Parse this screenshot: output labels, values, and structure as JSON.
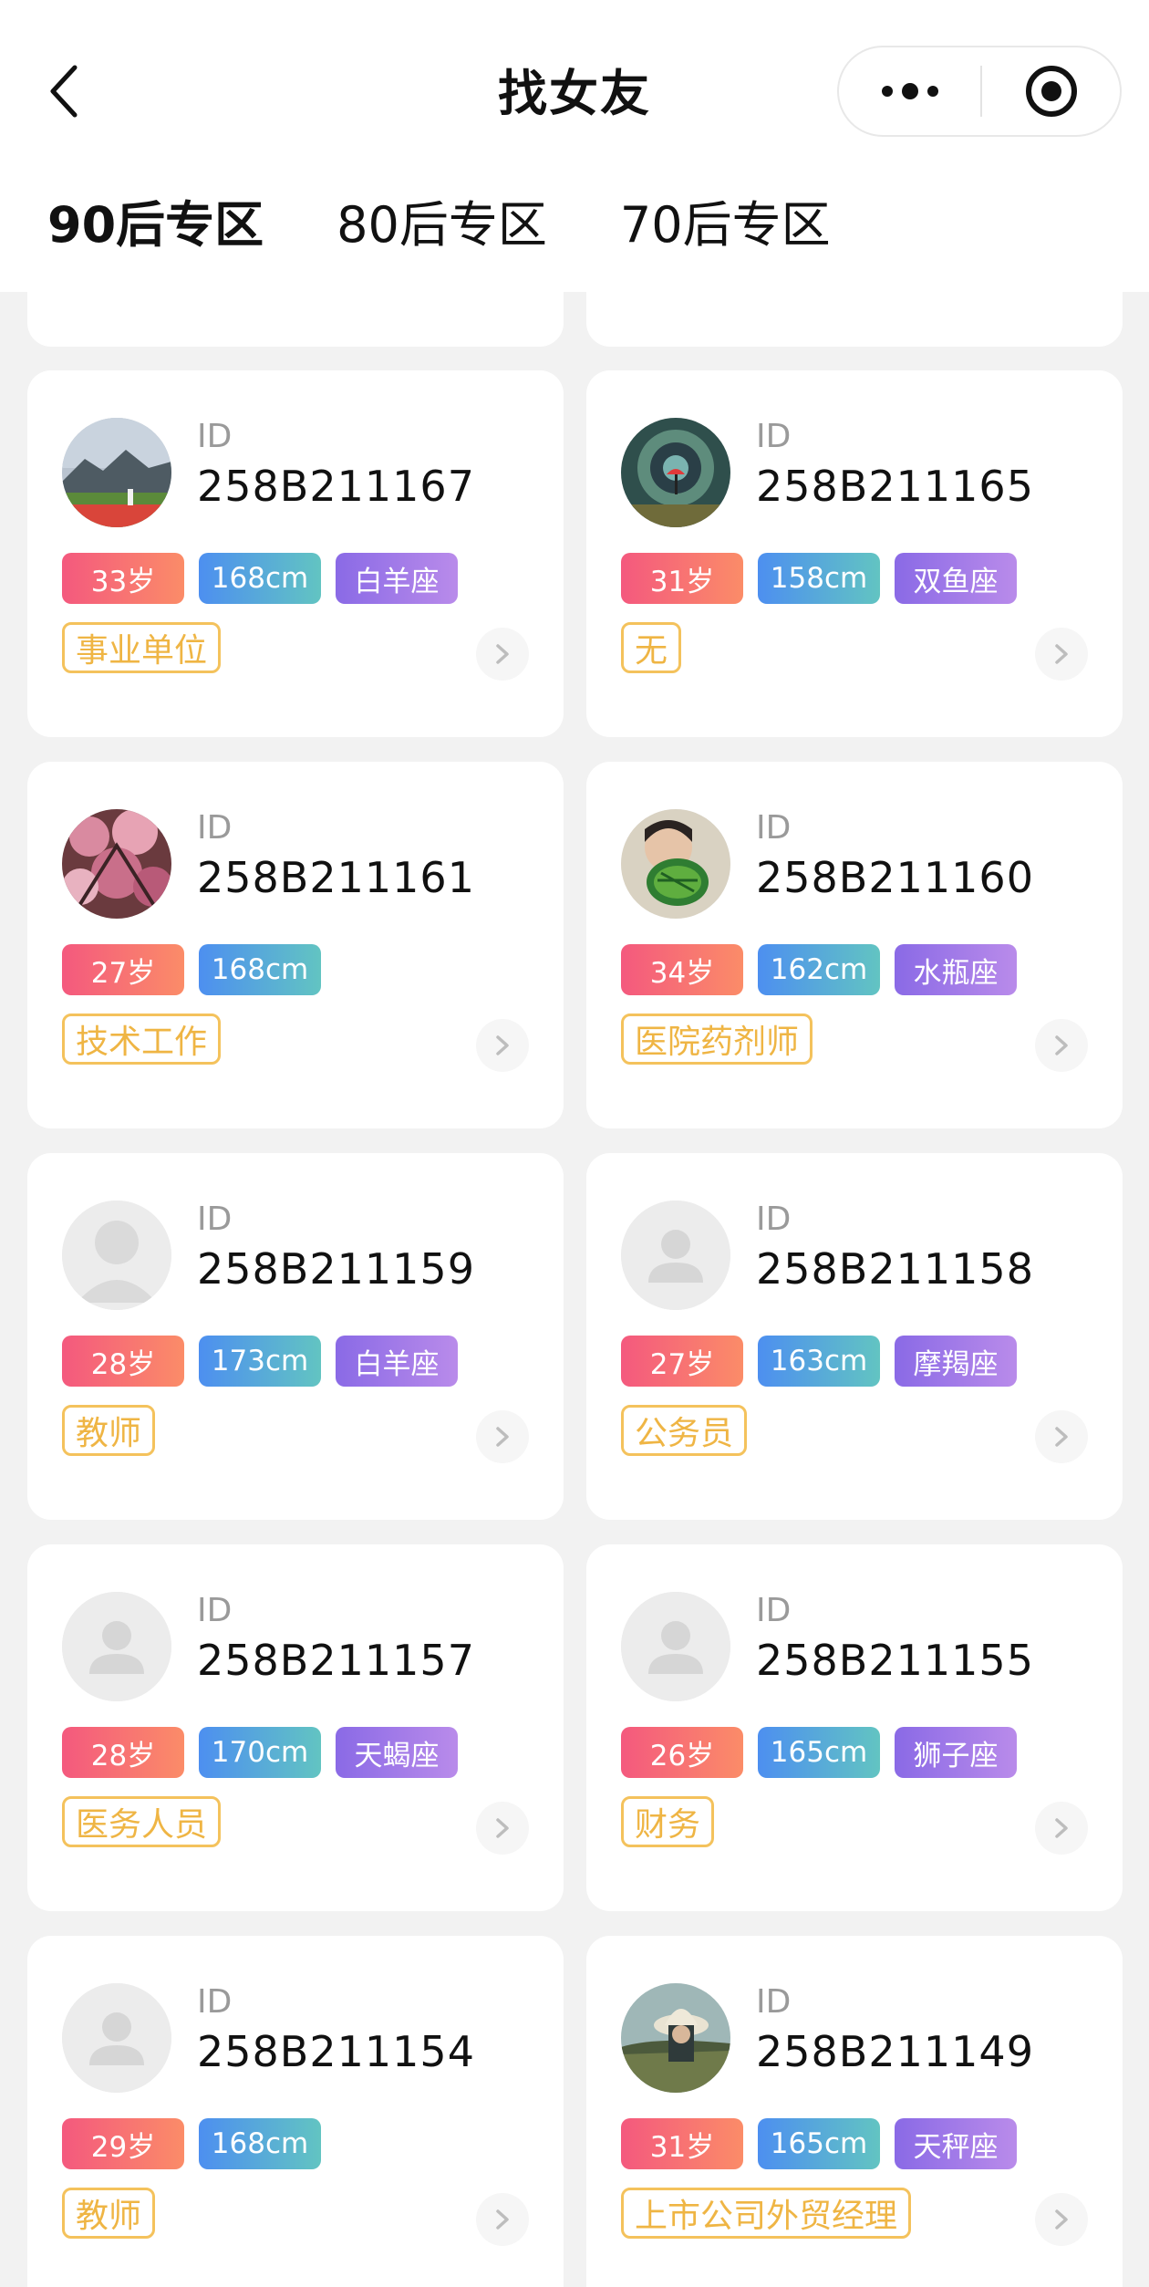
{
  "header": {
    "title": "找女友"
  },
  "tabs": [
    "90后专区",
    "80后专区",
    "70后专区"
  ],
  "profiles": [
    {
      "id_label": "ID",
      "id": "258B211167",
      "age": "33岁",
      "height": "168cm",
      "zodiac": "白羊座",
      "job": "事业单位",
      "avatar": "photo-mountains"
    },
    {
      "id_label": "ID",
      "id": "258B211165",
      "age": "31岁",
      "height": "158cm",
      "zodiac": "双鱼座",
      "job": "无",
      "avatar": "photo-art"
    },
    {
      "id_label": "ID",
      "id": "258B211161",
      "age": "27岁",
      "height": "168cm",
      "zodiac": "",
      "job": "技术工作",
      "avatar": "photo-flowers"
    },
    {
      "id_label": "ID",
      "id": "258B211160",
      "age": "34岁",
      "height": "162cm",
      "zodiac": "水瓶座",
      "job": "医院药剂师",
      "avatar": "photo-watermelon"
    },
    {
      "id_label": "ID",
      "id": "258B211159",
      "age": "28岁",
      "height": "173cm",
      "zodiac": "白羊座",
      "job": "教师",
      "avatar": "default"
    },
    {
      "id_label": "ID",
      "id": "258B211158",
      "age": "27岁",
      "height": "163cm",
      "zodiac": "摩羯座",
      "job": "公务员",
      "avatar": "default"
    },
    {
      "id_label": "ID",
      "id": "258B211157",
      "age": "28岁",
      "height": "170cm",
      "zodiac": "天蝎座",
      "job": "医务人员",
      "avatar": "default"
    },
    {
      "id_label": "ID",
      "id": "258B211155",
      "age": "26岁",
      "height": "165cm",
      "zodiac": "狮子座",
      "job": "财务",
      "avatar": "default"
    },
    {
      "id_label": "ID",
      "id": "258B211154",
      "age": "29岁",
      "height": "168cm",
      "zodiac": "",
      "job": "教师",
      "avatar": "default"
    },
    {
      "id_label": "ID",
      "id": "258B211149",
      "age": "31岁",
      "height": "165cm",
      "zodiac": "天秤座",
      "job": "上市公司外贸经理",
      "avatar": "photo-hat"
    }
  ]
}
